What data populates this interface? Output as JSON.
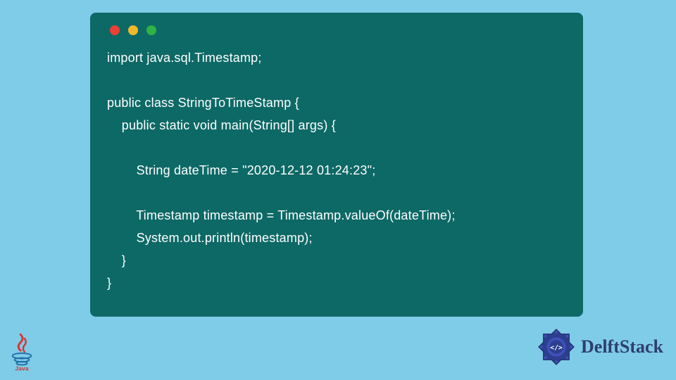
{
  "code": {
    "line1": "import java.sql.Timestamp;",
    "line2": "",
    "line3": "public class StringToTimeStamp {",
    "line4": "    public static void main(String[] args) {",
    "line5": "",
    "line6": "        String dateTime = \"2020-12-12 01:24:23\";",
    "line7": "",
    "line8": "        Timestamp timestamp = Timestamp.valueOf(dateTime);",
    "line9": "        System.out.println(timestamp);",
    "line10": "    }",
    "line11": "}"
  },
  "logos": {
    "java": "Java",
    "delftstack": "DelftStack"
  },
  "colors": {
    "background": "#7fcce8",
    "codeBackground": "#0d6966",
    "codeText": "#ffffff",
    "delftText": "#2d3e6f"
  }
}
